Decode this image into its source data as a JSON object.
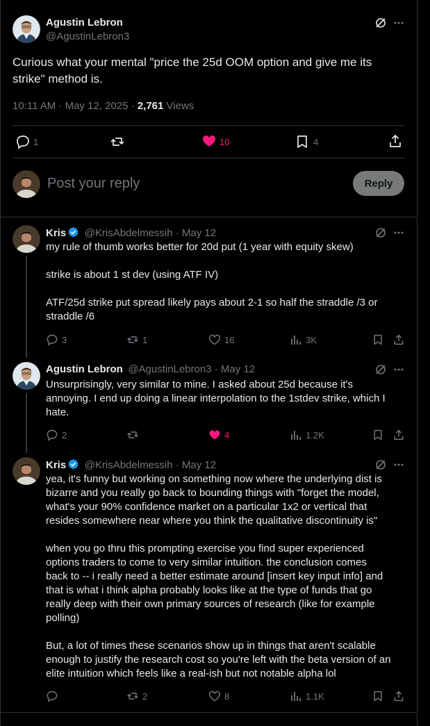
{
  "main_tweet": {
    "author_name": "Agustin Lebron",
    "author_handle": "@AgustinLebron3",
    "text": "Curious what your mental \"price the 25d OOM option and give me its strike\" method is.",
    "timestamp": "10:11 AM · May 12, 2025 · ",
    "views_count": "2,761",
    "views_label": " Views",
    "replies": "1",
    "likes": "10",
    "bookmarks": "4"
  },
  "compose": {
    "placeholder": "Post your reply",
    "reply_label": "Reply"
  },
  "replies": [
    {
      "author_name": "Kris",
      "author_handle": "@KrisAbdelmessih · May 12",
      "text": "my rule of thumb works better for 20d put (1 year with equity skew)\n\nstrike is about 1 st dev (using ATF IV)\n\nATF/25d strike put spread likely pays about 2-1 so half the straddle /3 or\nstraddle /6",
      "replies": "3",
      "reposts": "1",
      "likes": "16",
      "views": "3K"
    },
    {
      "author_name": "Agustin Lebron",
      "author_handle": "@AgustinLebron3 · May 12",
      "text": "Unsurprisingly, very similar to mine. I asked about 25d because it's\nannoying. I end up doing a linear interpolation to the 1stdev strike, which I\nhate.",
      "replies": "2",
      "likes": "4",
      "views": "1.2K"
    },
    {
      "author_name": "Kris",
      "author_handle": "@KrisAbdelmessih · May 12",
      "text": "yea, it's funny but working on something now where the underlying dist is\nbizarre and you really go back to bounding things with \"forget the model,\nwhat's your 90% confidence market on a particular 1x2 or vertical that\nresides somewhere near where you think the qualitative discontinuity is\"\n\nwhen you go thru this prompting exercise you find super experienced\noptions traders to come to very similar intuition. the conclusion comes\nback to -- i really need a better estimate around [insert key input info] and\nthat is what i think alpha probably looks like at the type of funds that go\nreally deep with their own primary sources of research (like for example\npolling)\n\nBut, a lot of times these scenarios show up in things that aren't scalable\nenough to justify the research cost so you're left with the beta version of an\nelite intuition which feels like a real-ish but not notable alpha lol",
      "reposts": "2",
      "likes": "8",
      "views": "1.1K"
    }
  ],
  "colors": {
    "background": "#000000",
    "text": "#e7e9ea",
    "muted": "#71767b",
    "like_pink": "#f91880",
    "verified_blue": "#1d9bf0",
    "reply_button": "#787a7a"
  }
}
